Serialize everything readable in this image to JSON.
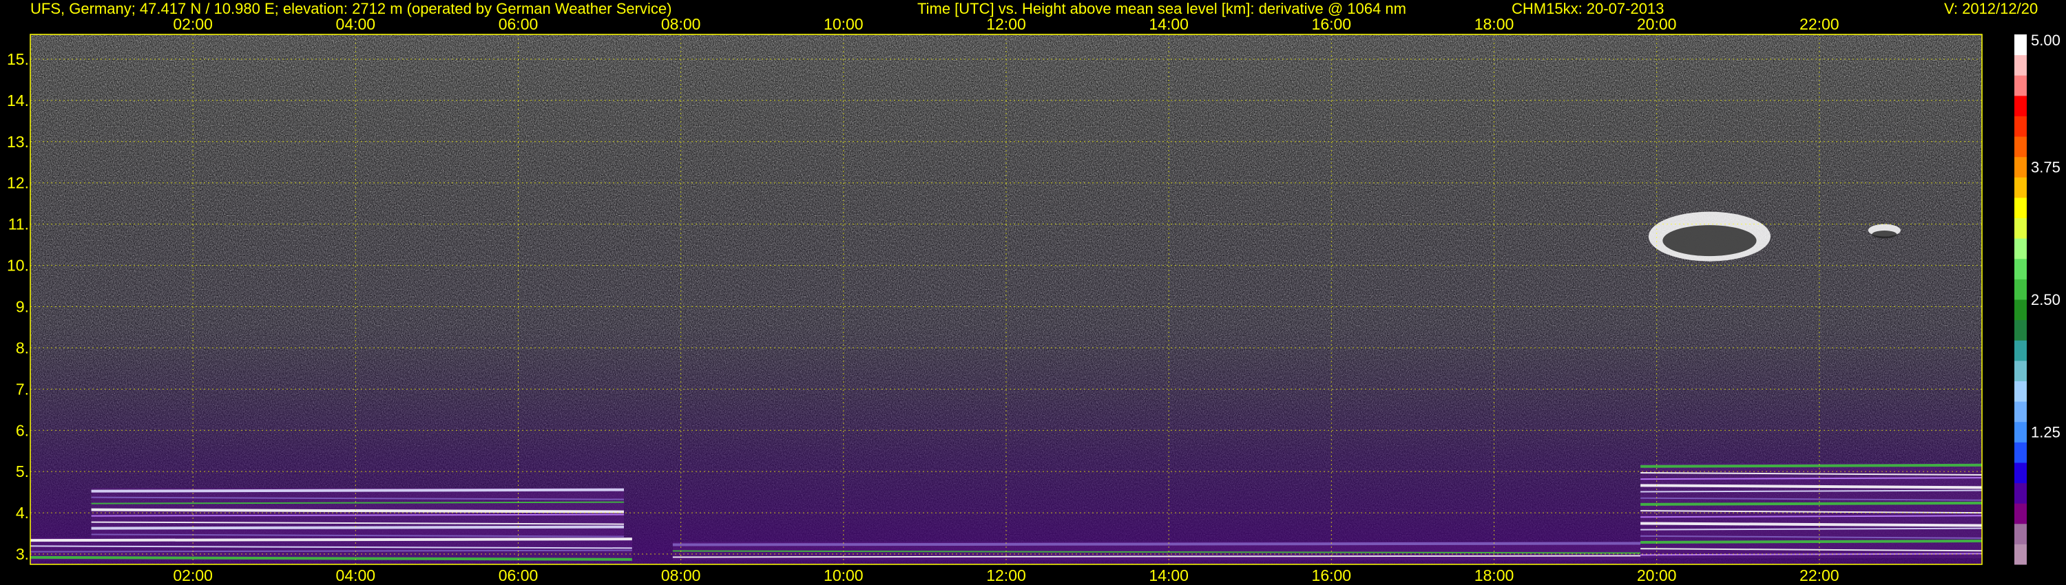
{
  "header": {
    "station": "UFS, Germany; 47.417 N / 10.980 E; elevation: 2712 m  (operated by German Weather Service)",
    "axes": "Time [UTC] vs. Height above mean sea level [km]: derivative @ 1064 nm",
    "instrument": "CHM15kx: 20-07-2013",
    "version": "V: 2012/12/20"
  },
  "chart_data": {
    "type": "heatmap",
    "title": "Time [UTC] vs. Height above mean sea level [km]: derivative @ 1064 nm",
    "xlabel": "Time [UTC]",
    "ylabel": "Height above mean sea level [km]",
    "x_ticks": [
      "02:00",
      "04:00",
      "06:00",
      "08:00",
      "10:00",
      "12:00",
      "14:00",
      "16:00",
      "18:00",
      "20:00",
      "22:00"
    ],
    "x_tick_hours": [
      2,
      4,
      6,
      8,
      10,
      12,
      14,
      16,
      18,
      20,
      22
    ],
    "xlim": [
      0,
      24
    ],
    "y_ticks": [
      "3.",
      "4.",
      "5.",
      "6.",
      "7.",
      "8.",
      "9.",
      "10.",
      "11.",
      "12.",
      "13.",
      "14.",
      "15."
    ],
    "y_tick_values": [
      3,
      4,
      5,
      6,
      7,
      8,
      9,
      10,
      11,
      12,
      13,
      14,
      15
    ],
    "ylim": [
      2.75,
      15.6
    ],
    "grid": true,
    "colorbar": {
      "ticks": [
        "5.00",
        "3.75",
        "2.50",
        "1.25"
      ],
      "tick_values": [
        5.0,
        3.75,
        2.5,
        1.25
      ],
      "range": [
        0,
        5
      ],
      "colors": [
        "#b890b0",
        "#a070a0",
        "#800080",
        "#5000a0",
        "#2000e0",
        "#2050ff",
        "#4090ff",
        "#70b0ff",
        "#a0d0ff",
        "#70c0d0",
        "#30a0a0",
        "#208040",
        "#209020",
        "#40c040",
        "#60e060",
        "#a0ff80",
        "#e0ff40",
        "#ffff00",
        "#ffc000",
        "#ff9000",
        "#ff6000",
        "#ff3000",
        "#ff0000",
        "#ff8080",
        "#ffc0c0",
        "#ffffff"
      ]
    },
    "features": [
      {
        "name": "aerosol layer (lower)",
        "t_start": 0.0,
        "t_end": 7.4,
        "h_bottom": 2.85,
        "h_top": 3.4
      },
      {
        "name": "aerosol layer (upper)",
        "t_start": 0.75,
        "t_end": 7.3,
        "h_bottom": 3.4,
        "h_top": 4.6
      },
      {
        "name": "surface layer",
        "t_start": 7.9,
        "t_end": 19.8,
        "h_bottom": 2.85,
        "h_top": 3.3
      },
      {
        "name": "aerosol layer (evening)",
        "t_start": 19.8,
        "t_end": 24.0,
        "h_bottom": 2.9,
        "h_top": 5.2
      },
      {
        "name": "cloud",
        "t_start": 19.9,
        "t_end": 21.4,
        "h_bottom": 10.1,
        "h_top": 11.3
      },
      {
        "name": "small cloud",
        "t_start": 22.6,
        "t_end": 23.0,
        "h_bottom": 10.7,
        "h_top": 11.0
      }
    ]
  }
}
